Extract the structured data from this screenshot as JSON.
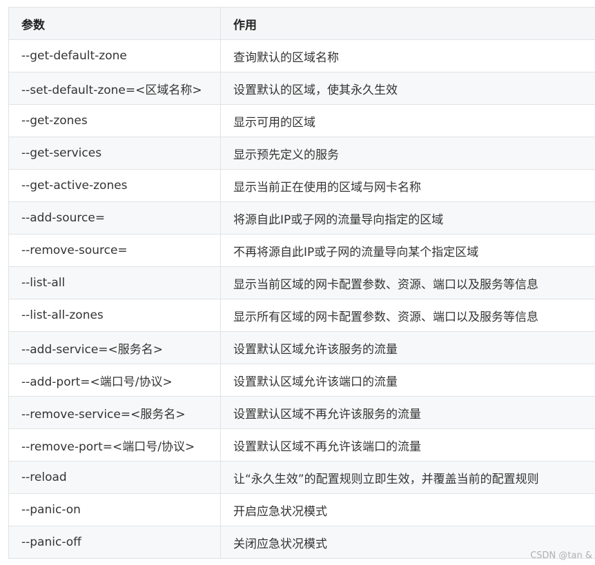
{
  "table": {
    "headers": [
      "参数",
      "作用"
    ],
    "rows": [
      [
        "--get-default-zone",
        "查询默认的区域名称"
      ],
      [
        "--set-default-zone=<区域名称>",
        "设置默认的区域，使其永久生效"
      ],
      [
        "--get-zones",
        "显示可用的区域"
      ],
      [
        "--get-services",
        "显示预先定义的服务"
      ],
      [
        "--get-active-zones",
        "显示当前正在使用的区域与网卡名称"
      ],
      [
        "--add-source=",
        "将源自此IP或子网的流量导向指定的区域"
      ],
      [
        "--remove-source=",
        "不再将源自此IP或子网的流量导向某个指定区域"
      ],
      [
        "--list-all",
        "显示当前区域的网卡配置参数、资源、端口以及服务等信息"
      ],
      [
        "--list-all-zones",
        "显示所有区域的网卡配置参数、资源、端口以及服务等信息"
      ],
      [
        "--add-service=<服务名>",
        "设置默认区域允许该服务的流量"
      ],
      [
        "--add-port=<端口号/协议>",
        "设置默认区域允许该端口的流量"
      ],
      [
        "--remove-service=<服务名>",
        "设置默认区域不再允许该服务的流量"
      ],
      [
        "--remove-port=<端口号/协议>",
        "设置默认区域不再允许该端口的流量"
      ],
      [
        "--reload",
        "让“永久生效”的配置规则立即生效，并覆盖当前的配置规则"
      ],
      [
        "--panic-on",
        "开启应急状况模式"
      ],
      [
        "--panic-off",
        "关闭应急状况模式"
      ]
    ]
  },
  "watermark": "CSDN @tan &"
}
